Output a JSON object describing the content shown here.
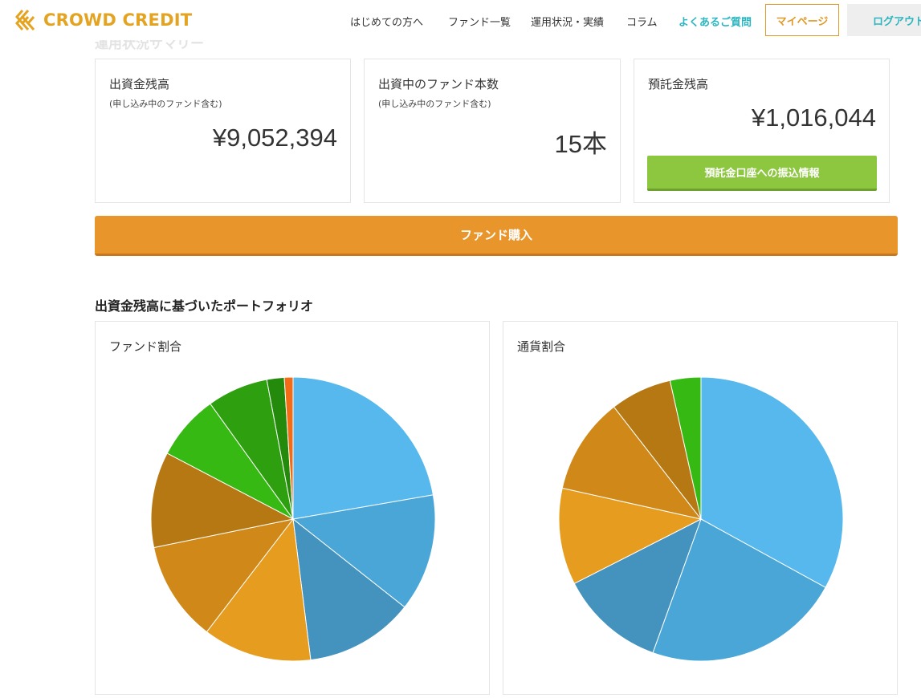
{
  "header": {
    "logo_text": "CROWD CREDIT",
    "nav": [
      {
        "label": "はじめての方へ"
      },
      {
        "label": "ファンド一覧"
      },
      {
        "label": "運用状況・実績"
      },
      {
        "label": "コラム"
      },
      {
        "label": "よくあるご質問"
      }
    ],
    "mypage_label": "マイページ",
    "login_label": "ログアウト"
  },
  "summary": {
    "heading": "運用状況サマリー",
    "balance": {
      "title": "出資金残高",
      "sub": "(申し込み中のファンド含む)",
      "value": "¥9,052,394"
    },
    "funds": {
      "title": "出資中のファンド本数",
      "sub": "(申し込み中のファンド含む)",
      "value": "15本"
    },
    "deposit": {
      "title": "預託金残高",
      "value": "¥1,016,044",
      "button_label": "預託金口座への振込情報"
    }
  },
  "buy_button_label": "ファンド購入",
  "portfolio_title": "出資金残高に基づいたポートフォリオ",
  "colors": {
    "accent_orange": "#e8952c",
    "accent_green": "#8dc63f",
    "brand_gold": "#e4a321",
    "link_teal": "#2bb5c0"
  },
  "chart_data": [
    {
      "type": "pie",
      "title": "ファンド割合",
      "values": [
        22.5,
        13.5,
        12.5,
        12.5,
        11.5,
        11.0,
        7.5,
        7.0,
        2.0,
        1.0
      ],
      "colors": [
        "#56b8ec",
        "#4aa6d6",
        "#4492be",
        "#e69c1e",
        "#d08818",
        "#b57812",
        "#36b912",
        "#2ea00f",
        "#238a0b",
        "#f26b16"
      ]
    },
    {
      "type": "pie",
      "title": "通貨割合",
      "values": [
        33.0,
        22.5,
        12.0,
        11.0,
        11.0,
        7.0,
        3.5
      ],
      "colors": [
        "#56b8ec",
        "#4aa6d6",
        "#4492be",
        "#e69c1e",
        "#d08818",
        "#b57812",
        "#36b912"
      ]
    }
  ]
}
